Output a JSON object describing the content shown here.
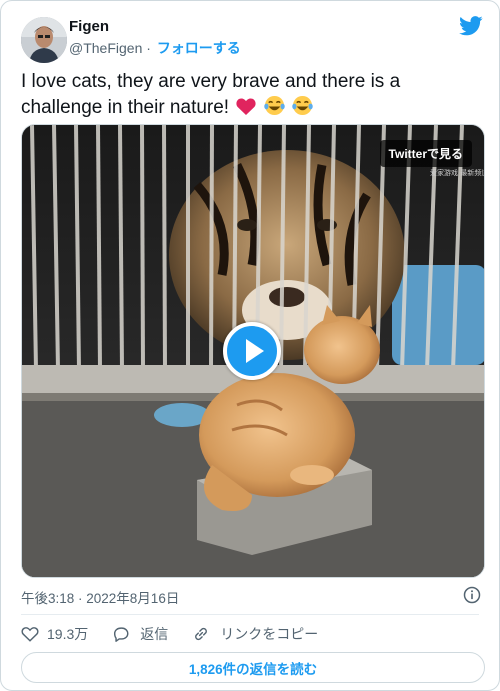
{
  "author": {
    "name": "Figen",
    "handle": "@TheFigen",
    "separator": "·",
    "follow_label": "フォローする"
  },
  "tweet": {
    "text": "I love cats, they are very brave and there is a challenge in their nature!",
    "emojis": [
      "heart-emoji",
      "laughing-tears-emoji",
      "laughing-tears-emoji"
    ]
  },
  "media": {
    "watch_label": "Twitterで見る",
    "watermark": "爱家游戏 最新频道"
  },
  "meta": {
    "timestamp": "午後3:18 · 2022年8月16日"
  },
  "actions": {
    "likes": "19.3万",
    "reply_label": "返信",
    "copy_link_label": "リンクをコピー"
  },
  "read_replies_label": "1,826件の返信を読む",
  "colors": {
    "accent": "#1d9bf0",
    "heart": "#e0245e",
    "muted": "#536471",
    "border": "#cfd9de"
  },
  "icons": [
    "twitter-bird-icon",
    "info-icon",
    "heart-icon",
    "reply-icon",
    "link-icon",
    "play-icon"
  ]
}
